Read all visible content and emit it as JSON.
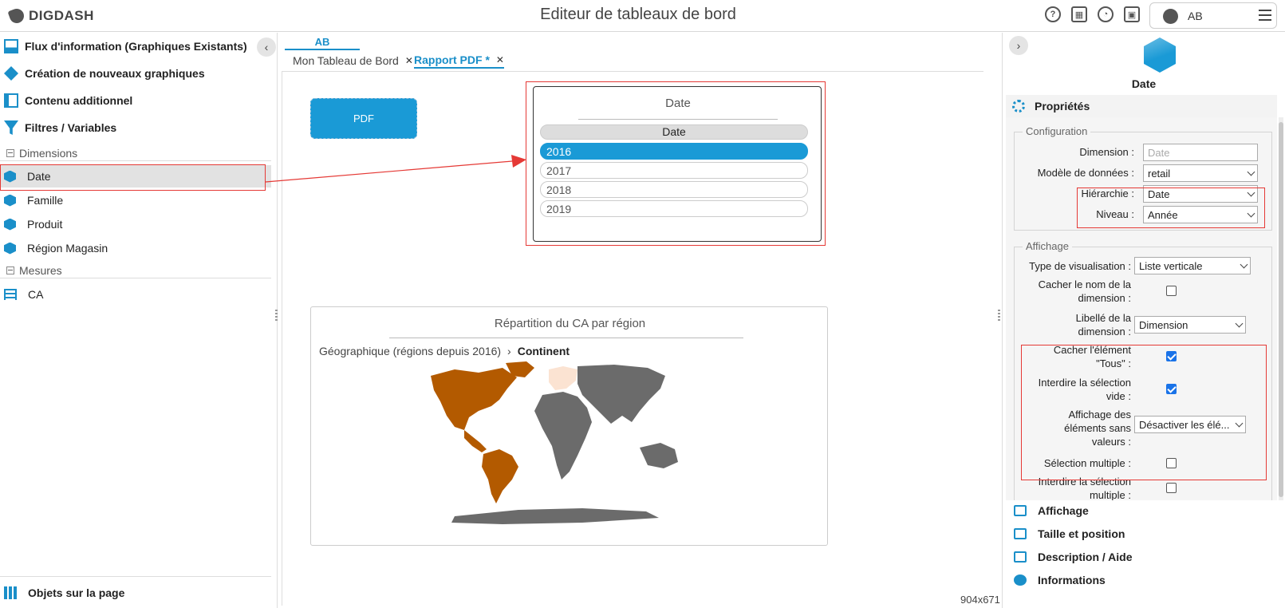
{
  "app": {
    "logo_text": "DIGDASH",
    "title": "Editeur de tableaux de bord",
    "user_initials": "AB"
  },
  "left_panel": {
    "sections": [
      {
        "label": "Flux d'information (Graphiques Existants)"
      },
      {
        "label": "Création de nouveaux graphiques"
      },
      {
        "label": "Contenu additionnel"
      },
      {
        "label": "Filtres / Variables"
      }
    ],
    "dimensions_header": "Dimensions",
    "dimensions": [
      "Date",
      "Famille",
      "Produit",
      "Région Magasin"
    ],
    "measures_header": "Mesures",
    "measures": [
      "CA"
    ],
    "bottom_label": "Objets sur la page"
  },
  "center": {
    "tab_group": "AB",
    "tabs": [
      {
        "label": "Mon Tableau de Bord",
        "close": "✕"
      },
      {
        "label": "Rapport PDF *",
        "close": "✕"
      }
    ],
    "pdf_button": "PDF",
    "date_widget": {
      "title": "Date",
      "column_header": "Date",
      "items": [
        "2016",
        "2017",
        "2018",
        "2019"
      ],
      "selected": "2016"
    },
    "map_widget": {
      "title": "Répartition du CA par région",
      "breadcrumb_parent": "Géographique (régions depuis 2016)",
      "breadcrumb_sep": "›",
      "breadcrumb_current": "Continent",
      "colors": {
        "highlight": "#b35a00",
        "light": "#fbe3d2",
        "neutral": "#6b6b6b"
      }
    },
    "size_label": "904x671"
  },
  "right_panel": {
    "object_name": "Date",
    "properties_header": "Propriétés",
    "configuration": {
      "legend": "Configuration",
      "dimension_label": "Dimension :",
      "dimension_placeholder": "Date",
      "model_label": "Modèle de données :",
      "model_value": "retail",
      "hierarchy_label": "Hiérarchie :",
      "hierarchy_value": "Date",
      "level_label": "Niveau :",
      "level_value": "Année"
    },
    "display": {
      "legend": "Affichage",
      "vis_type_label": "Type de visualisation :",
      "vis_type_value": "Liste verticale",
      "hide_dim_name_label": "Cacher le nom de la dimension :",
      "dim_label_label": "Libellé de la dimension :",
      "dim_label_value": "Dimension",
      "hide_all_label": "Cacher l'élément \"Tous\" :",
      "forbid_empty_label": "Interdire la sélection vide :",
      "no_value_display_label": "Affichage des éléments sans valeurs :",
      "no_value_display_value": "Désactiver les élé...",
      "multi_select_label": "Sélection multiple :",
      "forbid_multi_label": "Interdire la sélection multiple :"
    },
    "sections": [
      "Affichage",
      "Taille et position",
      "Description / Aide",
      "Informations"
    ]
  }
}
